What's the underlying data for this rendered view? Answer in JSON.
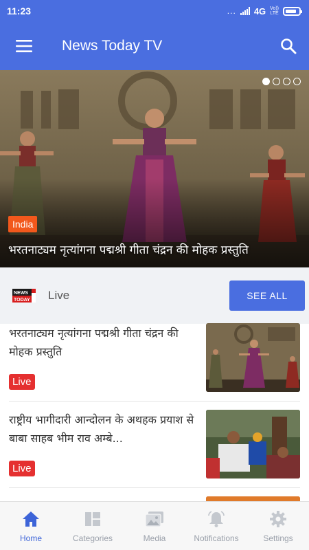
{
  "status_bar": {
    "time": "11:23",
    "dots": "...",
    "network": "4G",
    "carrier_top": "Vo))",
    "carrier_bottom": "LTE",
    "battery_level": 0.85
  },
  "app_bar": {
    "title": "News Today TV",
    "menu_icon": "hamburger-menu-icon",
    "search_icon": "search-icon"
  },
  "hero": {
    "category": "India",
    "title": "भरतनाट्यम नृत्यांगना पद्मश्री गीता चंद्रन की मोहक प्रस्तुति",
    "carousel_dots": 4,
    "active_dot": 0
  },
  "section": {
    "title": "Live",
    "see_all_label": "SEE ALL",
    "logo_line1": "NEWS",
    "logo_line2": "TODAY"
  },
  "news_items": [
    {
      "title": "भरतनाट्यम नृत्यांगना पद्मश्री गीता चंद्रन की मोहक प्रस्तुति",
      "badge": "Live"
    },
    {
      "title": "राष्ट्रीय भागीदारी आन्दोलन के अथहक प्रयाश से बाबा साहब भीम राव अम्बे...",
      "badge": "Live"
    },
    {
      "title": "",
      "badge": ""
    }
  ],
  "bottom_nav": {
    "items": [
      {
        "label": "Home",
        "icon": "home-icon",
        "active": true
      },
      {
        "label": "Categories",
        "icon": "categories-icon",
        "active": false
      },
      {
        "label": "Media",
        "icon": "media-icon",
        "active": false
      },
      {
        "label": "Notifications",
        "icon": "bell-icon",
        "active": false
      },
      {
        "label": "Settings",
        "icon": "gear-icon",
        "active": false
      }
    ]
  },
  "colors": {
    "primary": "#4a6ee0",
    "category_badge": "#f2581c",
    "live_badge": "#e53030",
    "nav_active": "#3d64d8",
    "nav_inactive": "#9aa0aa"
  }
}
